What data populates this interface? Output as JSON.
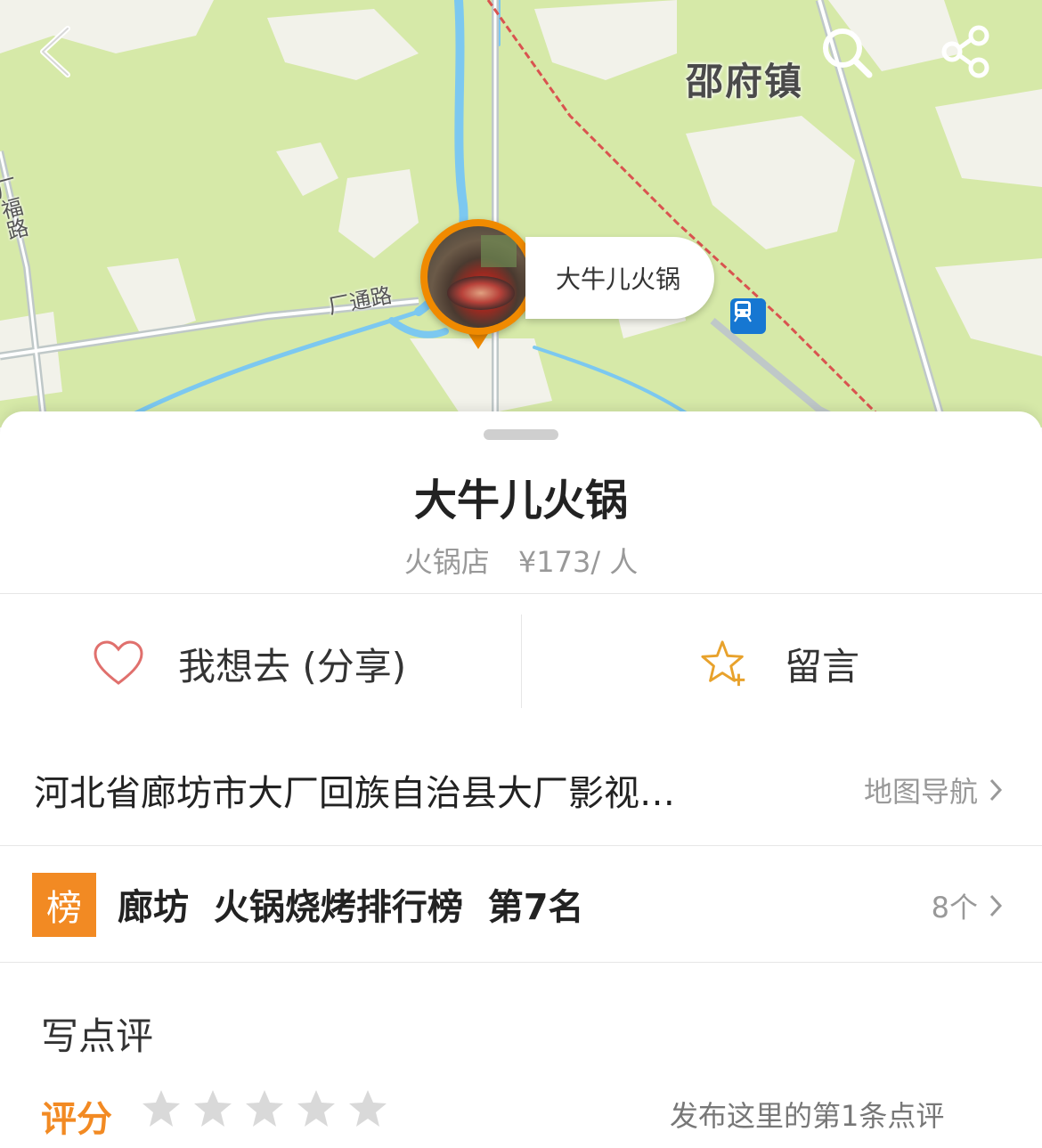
{
  "map": {
    "town_label": "邵府镇",
    "road_labels": [
      "厂通路",
      "厂福路"
    ],
    "pin_label": "大牛儿火锅"
  },
  "header": {
    "back_icon": "chevron-left-icon",
    "search_icon": "search-icon",
    "share_icon": "share-icon"
  },
  "place": {
    "name": "大牛儿火锅",
    "category": "火锅店",
    "price": "¥173/ 人"
  },
  "actions": {
    "want_label": "我想去 (分享)",
    "comment_label": "留言"
  },
  "address": {
    "text": "河北省廊坊市大厂回族自治县大厂影视…",
    "nav_label": "地图导航"
  },
  "ranking": {
    "badge": "榜",
    "text": "廊坊  火锅烧烤排行榜  第7名",
    "count": "8个"
  },
  "review": {
    "title": "写点评",
    "rating_label": "评分",
    "rating_value": 0,
    "rating_max": 5,
    "publish_label": "发布这里的第1条点评"
  },
  "colors": {
    "accent": "#f28a23",
    "pin": "#f08a00",
    "map_green": "#d6e9a8",
    "river": "#7cc8f0",
    "railway": "#d9534f"
  }
}
